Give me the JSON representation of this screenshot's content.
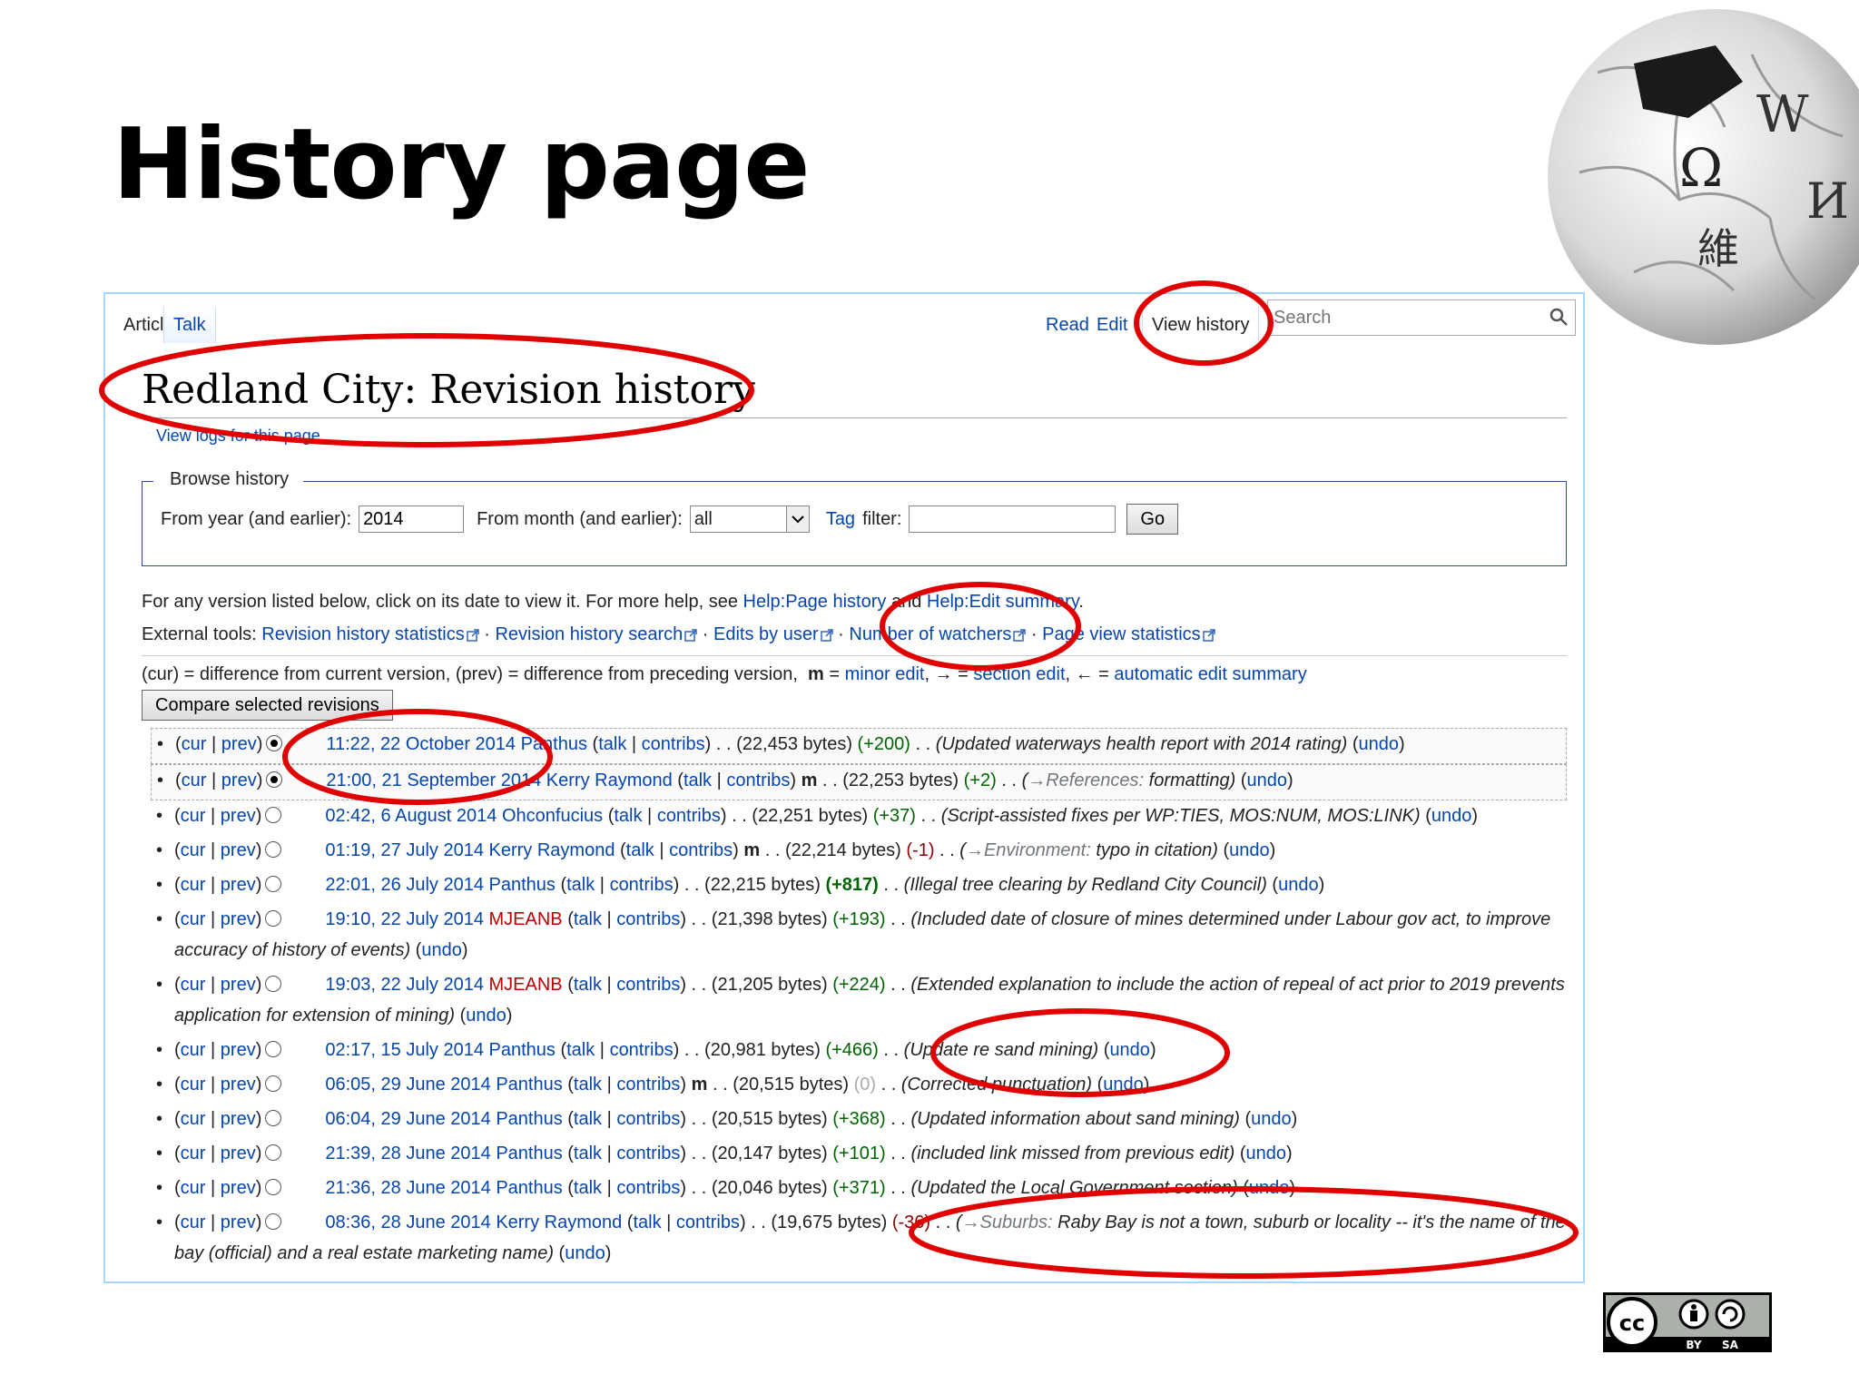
{
  "slide": {
    "title": "History page"
  },
  "tabs": {
    "article": "Article",
    "talk": "Talk",
    "read": "Read",
    "edit": "Edit",
    "history": "View history"
  },
  "search": {
    "placeholder": "Search"
  },
  "page": {
    "heading": "Redland City: Revision history",
    "view_logs": "View logs for this page"
  },
  "browse": {
    "legend": "Browse history",
    "year_label": "From year (and earlier):",
    "year_value": "2014",
    "month_label": "From month (and earlier):",
    "month_value": "all",
    "tag_link": "Tag",
    "tag_label": "filter:",
    "go": "Go"
  },
  "info": {
    "text": "For any version listed below, click on its date to view it. For more help, see",
    "help1": "Help:Page history",
    "and": "and",
    "help2": "Help:Edit summary",
    "end": "."
  },
  "tools": {
    "label": "External tools:",
    "items": [
      "Revision history statistics",
      "Revision history search",
      "Edits by user",
      "Number of watchers",
      "Page view statistics"
    ]
  },
  "legend": {
    "text": "(cur) = difference from current version, (prev) = difference from preceding version,",
    "m": "m",
    "eq": " = ",
    "minor": "minor edit",
    "arrow": ", → = ",
    "section": "section edit",
    "back": ", ← = ",
    "auto": "automatic edit summary"
  },
  "compare_label": "Compare selected revisions",
  "labels": {
    "cur": "cur",
    "prev": "prev",
    "talk": "talk",
    "contribs": "contribs",
    "undo": "undo",
    "minor": "m"
  },
  "revisions": [
    {
      "date": "11:22, 22 October 2014",
      "user": "Panthus",
      "minor": "",
      "bytes": "(22,453 bytes)",
      "diff": "(+200)",
      "section": "",
      "comment": "Updated waterways health report with 2014 rating"
    },
    {
      "date": "21:00, 21 September 2014",
      "user": "Kerry Raymond",
      "minor": "m",
      "bytes": "(22,253 bytes)",
      "diff": "(+2)",
      "section": "→References:",
      "comment": "formatting"
    },
    {
      "date": "02:42, 6 August 2014",
      "user": "Ohconfucius",
      "minor": "",
      "bytes": "(22,251 bytes)",
      "diff": "(+37)",
      "section": "",
      "comment": "Script-assisted fixes per WP:TIES, MOS:NUM, MOS:LINK"
    },
    {
      "date": "01:19, 27 July 2014",
      "user": "Kerry Raymond",
      "minor": "m",
      "bytes": "(22,214 bytes)",
      "diff": "(-1)",
      "section": "→Environment:",
      "comment": "typo in citation"
    },
    {
      "date": "22:01, 26 July 2014",
      "user": "Panthus",
      "minor": "",
      "bytes": "(22,215 bytes)",
      "diff": "(+817)",
      "section": "",
      "comment": "Illegal tree clearing by Redland City Council"
    },
    {
      "date": "19:10, 22 July 2014",
      "user": "MJEANB",
      "minor": "",
      "bytes": "(21,398 bytes)",
      "diff": "(+193)",
      "section": "",
      "comment": "Included date of closure of mines determined under Labour gov act, to improve accuracy of history of events"
    },
    {
      "date": "19:03, 22 July 2014",
      "user": "MJEANB",
      "minor": "",
      "bytes": "(21,205 bytes)",
      "diff": "(+224)",
      "section": "",
      "comment": "Extended explanation to include the action of repeal of act prior to 2019 prevents application for extension of mining"
    },
    {
      "date": "02:17, 15 July 2014",
      "user": "Panthus",
      "minor": "",
      "bytes": "(20,981 bytes)",
      "diff": "(+466)",
      "section": "",
      "comment": "Update re sand mining"
    },
    {
      "date": "06:05, 29 June 2014",
      "user": "Panthus",
      "minor": "m",
      "bytes": "(20,515 bytes)",
      "diff": "(0)",
      "section": "",
      "comment": "Corrected punctuation"
    },
    {
      "date": "06:04, 29 June 2014",
      "user": "Panthus",
      "minor": "",
      "bytes": "(20,515 bytes)",
      "diff": "(+368)",
      "section": "",
      "comment": "Updated information about sand mining"
    },
    {
      "date": "21:39, 28 June 2014",
      "user": "Panthus",
      "minor": "",
      "bytes": "(20,147 bytes)",
      "diff": "(+101)",
      "section": "",
      "comment": "included link missed from previous edit"
    },
    {
      "date": "21:36, 28 June 2014",
      "user": "Panthus",
      "minor": "",
      "bytes": "(20,046 bytes)",
      "diff": "(+371)",
      "section": "",
      "comment": "Updated the Local Government section"
    },
    {
      "date": "08:36, 28 June 2014",
      "user": "Kerry Raymond",
      "minor": "",
      "bytes": "(19,675 bytes)",
      "diff": "(-36)",
      "section": "→Suburbs:",
      "comment": "Raby Bay is not a town, suburb or locality -- it's the name of the bay (official) and a real estate marketing name"
    }
  ],
  "license_badge": {
    "cc": "cc",
    "by": "BY",
    "sa": "SA"
  },
  "colors": {
    "annotation": "#e00000",
    "link": "#0645ad",
    "red_user": "#ba0000",
    "positive": "#006400",
    "negative": "#8b0000"
  },
  "icons": [
    "search-icon",
    "external-link-icon",
    "radio-button",
    "wikipedia-globe-logo",
    "creative-commons-by-sa-badge"
  ]
}
